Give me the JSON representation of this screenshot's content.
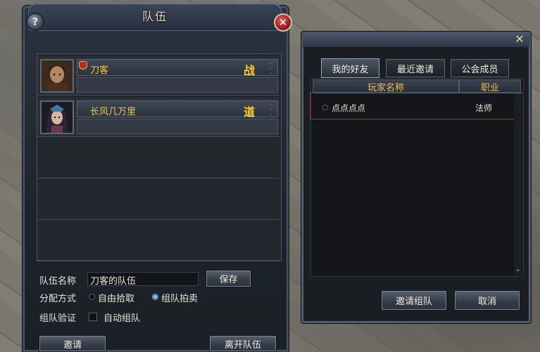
{
  "team_panel": {
    "title": "队伍",
    "help_icon": "?",
    "members": [
      {
        "name": "刀客",
        "class": "战",
        "leader": true
      },
      {
        "name": "长风几万里",
        "class": "道",
        "leader": false
      }
    ],
    "team_name_label": "队伍名称",
    "team_name_value": "刀客的队伍",
    "save_label": "保存",
    "distribution_label": "分配方式",
    "distribution_options": [
      {
        "label": "自由拾取",
        "selected": false
      },
      {
        "label": "组队拍卖",
        "selected": true
      }
    ],
    "verify_label": "组队验证",
    "auto_team_label": "自动组队",
    "auto_team_checked": false,
    "invite_label": "邀请",
    "leave_label": "离开队伍"
  },
  "friend_panel": {
    "close_icon": "✕",
    "tabs": [
      {
        "label": "我的好友",
        "active": true
      },
      {
        "label": "最近邀请",
        "active": false
      },
      {
        "label": "公会成员",
        "active": false
      }
    ],
    "columns": {
      "name": "玩家名称",
      "job": "职业"
    },
    "rows": [
      {
        "name": "点点点点",
        "job": "法师",
        "selected": true
      }
    ],
    "invite_team_label": "邀请组队",
    "cancel_label": "取消"
  }
}
